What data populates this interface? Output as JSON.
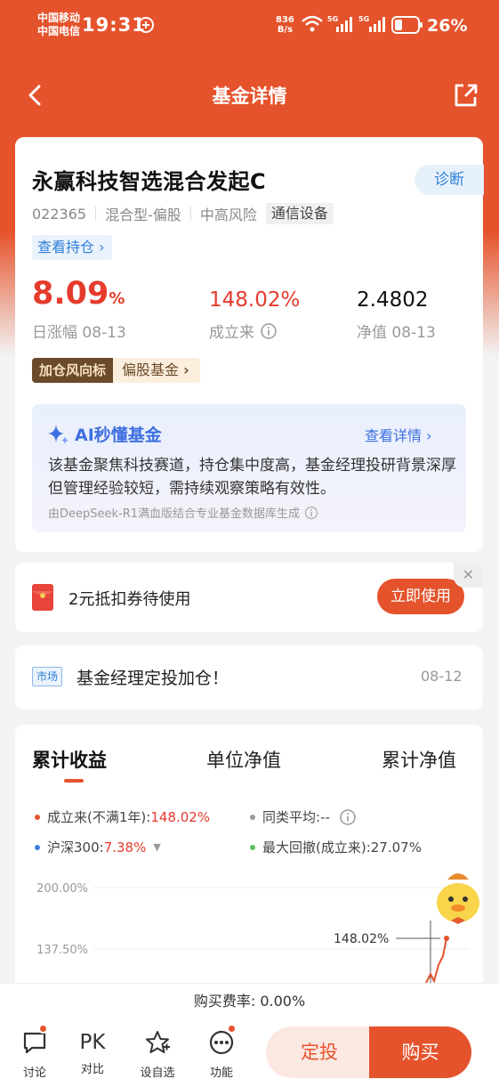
{
  "status": {
    "carrier1": "中国移动",
    "carrier2": "中国电信",
    "time": "19:31",
    "net_speed_num": "836",
    "net_speed_unit": "B/s",
    "battery": "26%"
  },
  "nav": {
    "title": "基金详情"
  },
  "fund": {
    "name": "永赢科技智选混合发起C",
    "diagnose": "诊断",
    "code": "022365",
    "type": "混合型-偏股",
    "risk": "中高风险",
    "industry": "通信设备",
    "holdings_link": "查看持仓 ›",
    "daily_change": "8.09",
    "daily_change_unit": "%",
    "daily_change_label": "日涨幅 08-13",
    "since_inception": "148.02%",
    "since_inception_label": "成立来",
    "nav_value": "2.4802",
    "nav_label": "净值 08-13",
    "badge_left": "加仓风向标",
    "badge_right": "偏股基金"
  },
  "ai": {
    "title": "AI秒懂基金",
    "link": "查看详情 ›",
    "body": "该基金聚焦科技赛道，持仓集中度高，基金经理投研背景深厚但管理经验较短，需持续观察策略有效性。",
    "source": "由DeepSeek-R1满血版结合专业基金数据库生成"
  },
  "coupon": {
    "text": "2元抵扣券待使用",
    "button": "立即使用",
    "close": "✕"
  },
  "news": {
    "tag": "市场",
    "text": "基金经理定投加仓！",
    "date": "08-12"
  },
  "chart_tabs": [
    "累计收益",
    "单位净值",
    "累计净值"
  ],
  "legend": {
    "fund_label": "成立来(不满1年):",
    "fund_value": "148.02%",
    "peer_label": "同类平均:",
    "peer_value": "--",
    "index_label": "沪深300:",
    "index_value": "7.38%",
    "drawdown_label": "最大回撤(成立来):",
    "drawdown_value": "27.07%"
  },
  "colors": {
    "brand": "#e5532c",
    "up": "#e53b2c",
    "link": "#2f7fd6",
    "peer": "#999999",
    "index": "#3d7fe0",
    "drawdown": "#5cbf5c"
  },
  "chart_data": {
    "type": "line",
    "yticks": [
      "200.00%",
      "137.50%"
    ],
    "series": [
      {
        "name": "成立来(不满1年)",
        "end_value": 148.02
      }
    ],
    "annotation": "148.02%"
  },
  "fee": "购买费率: 0.00%",
  "bottom": {
    "discuss": "讨论",
    "pk_icon": "PK",
    "pk": "对比",
    "watch": "设自选",
    "func": "功能",
    "dingtou": "定投",
    "buy": "购买"
  }
}
